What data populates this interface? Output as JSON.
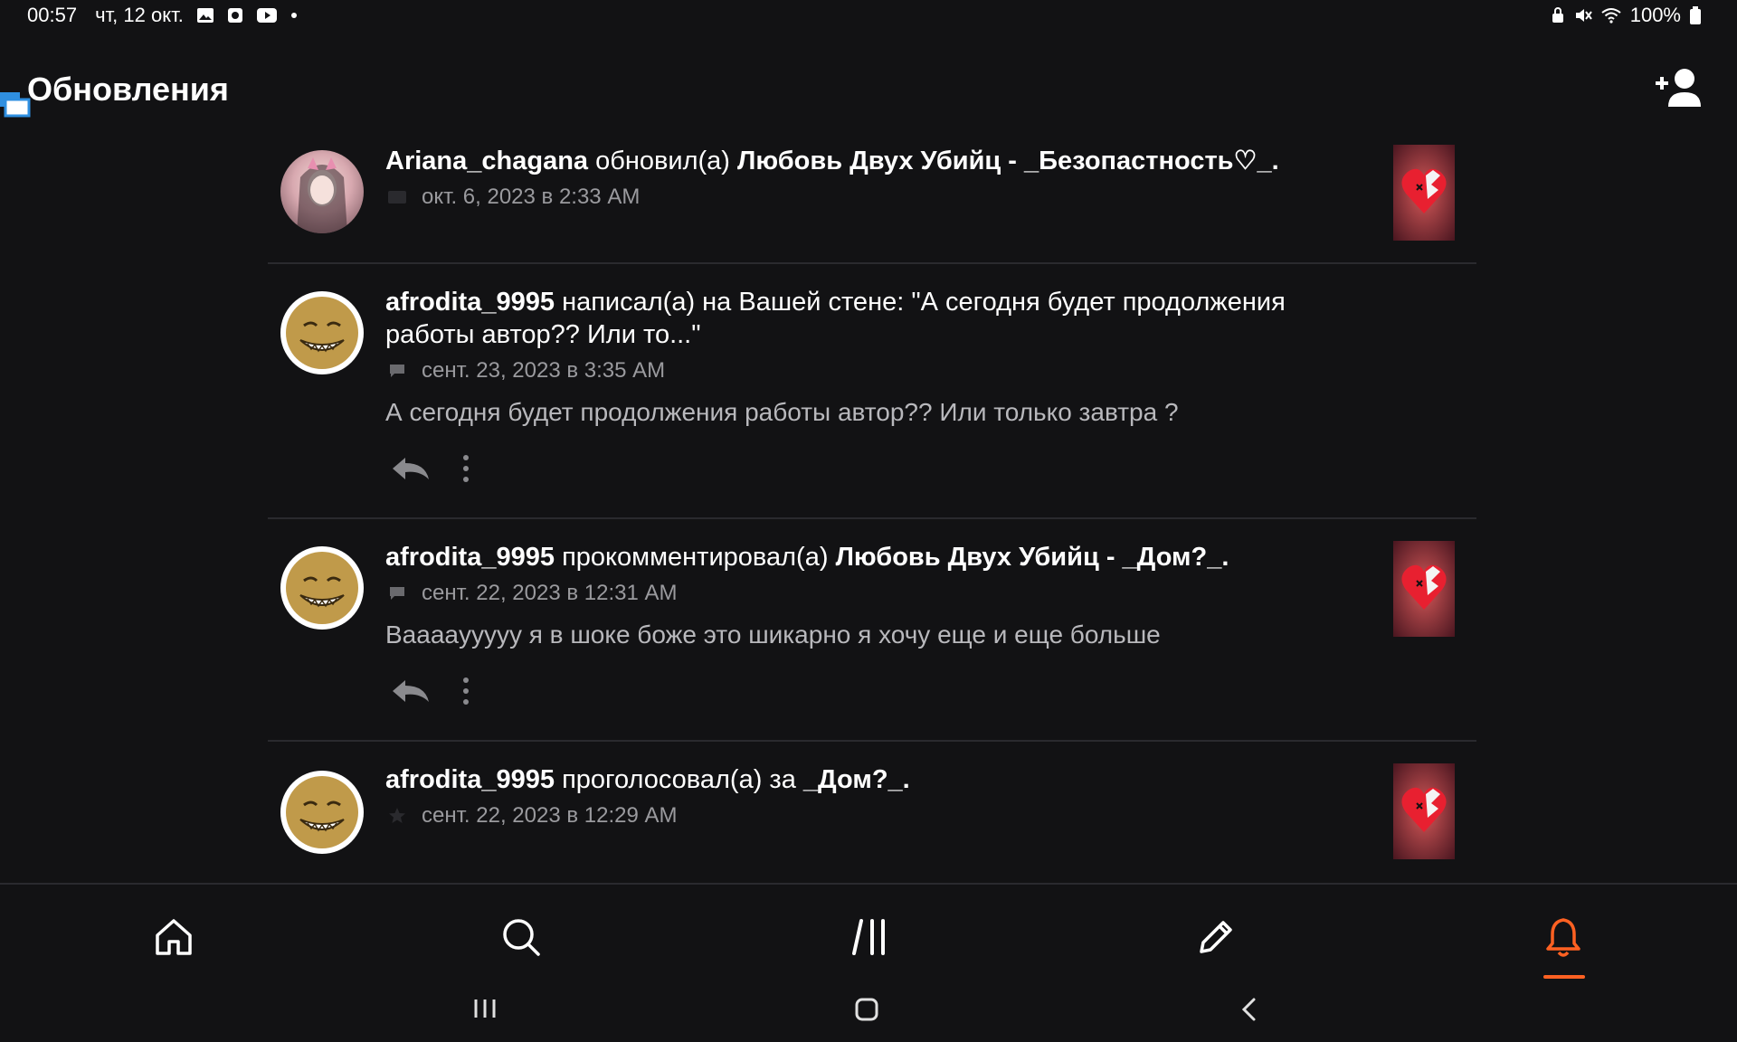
{
  "status_bar": {
    "time": "00:57",
    "date": "чт, 12 окт.",
    "battery": "100%"
  },
  "header": {
    "title": "Обновления"
  },
  "feed": [
    {
      "user": "Ariana_chagana",
      "action": "обновил(а)",
      "target": "Любовь Двух Убийц - _Безопастность♡_.",
      "timestamp": "окт. 6, 2023 в 2:33 AM",
      "meta_icon": "update-icon"
    },
    {
      "user": "afrodita_9995",
      "action": "написал(а) на Вашей стене: \"А сегодня будет продолжения работы автор?? Или то...\"",
      "timestamp": "сент. 23, 2023 в 3:35 AM",
      "excerpt": "А сегодня будет продолжения работы автор?? Или только завтра ?",
      "meta_icon": "comment-icon"
    },
    {
      "user": "afrodita_9995",
      "action": "прокомментировал(а)",
      "target": "Любовь Двух Убийц - _Дом?_.",
      "timestamp": "сент. 22, 2023 в 12:31 AM",
      "excerpt": "Вааааyyyyy я в шоке боже это шикарно я хочу еще и еще больше",
      "meta_icon": "comment-icon"
    },
    {
      "user": "afrodita_9995",
      "action": "проголосовал(а) за",
      "target": "_Дом?_.",
      "timestamp": "сент. 22, 2023 в 12:29 AM",
      "meta_icon": "star-icon"
    }
  ],
  "bottom_nav": {
    "items": [
      "home-icon",
      "search-icon",
      "library-icon",
      "write-icon",
      "notifications-icon"
    ],
    "active": "notifications-icon"
  },
  "colors": {
    "background": "#121214",
    "accent": "#ff6122",
    "muted_text": "#9a9a9e"
  }
}
